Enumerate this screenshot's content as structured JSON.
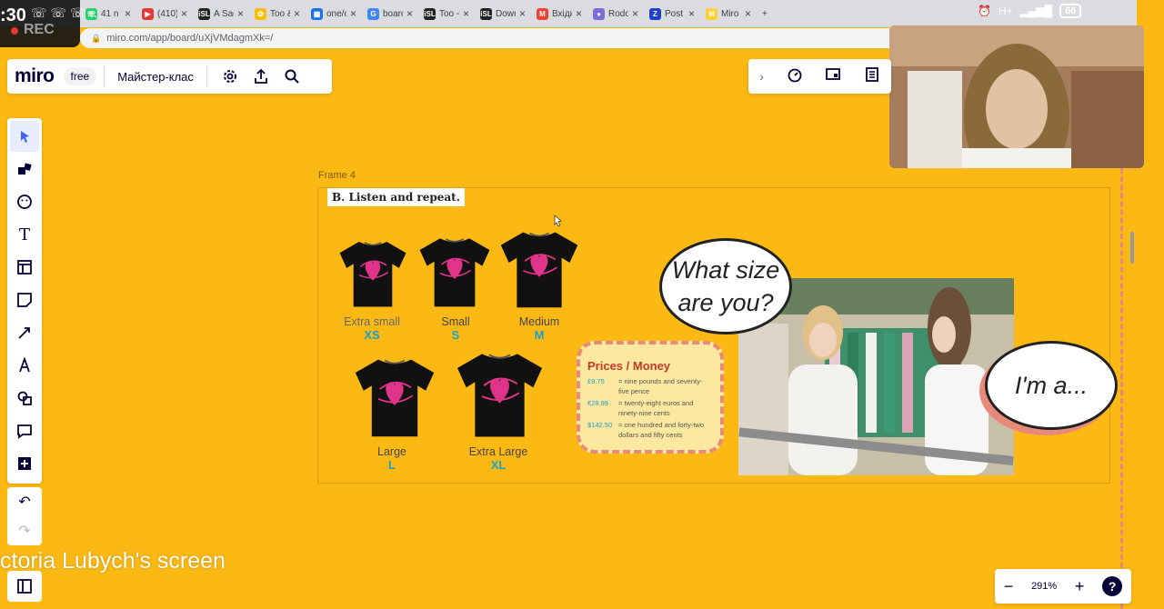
{
  "recording": {
    "time": ":30",
    "label": "REC"
  },
  "tabs": [
    {
      "label": "41 n",
      "color": "#25d366",
      "glyph": "☏"
    },
    {
      "label": "(410)",
      "color": "#e53935",
      "glyph": "▶"
    },
    {
      "label": "A Sad",
      "color": "#222222",
      "glyph": "iSL"
    },
    {
      "label": "Too &",
      "color": "#fbbc04",
      "glyph": "✿"
    },
    {
      "label": "one/c",
      "color": "#1a73e8",
      "glyph": "▦"
    },
    {
      "label": "board",
      "color": "#4285f4",
      "glyph": "G"
    },
    {
      "label": "Too -",
      "color": "#222222",
      "glyph": "iSL"
    },
    {
      "label": "Down",
      "color": "#222222",
      "glyph": "iSL"
    },
    {
      "label": "Вхідн",
      "color": "#ea4335",
      "glyph": "M"
    },
    {
      "label": "Rodo",
      "color": "#7b6cd9",
      "glyph": "●"
    },
    {
      "label": "Post A",
      "color": "#1e40c9",
      "glyph": "Z"
    },
    {
      "label": "Miro",
      "color": "#ffd02f",
      "glyph": "M"
    }
  ],
  "address": "miro.com/app/board/uXjVMdagmXk=/",
  "status": {
    "battery": "66",
    "net": "H+"
  },
  "toolbar": {
    "logo": "miro",
    "plan": "free",
    "board_name": "Майстер-клас"
  },
  "zoom": {
    "level": "291%",
    "minus": "−",
    "plus": "+",
    "help": "?"
  },
  "frame": {
    "label": "Frame 4",
    "title": "B. Listen and repeat."
  },
  "sizes": [
    {
      "name": "Extra small",
      "code": "XS"
    },
    {
      "name": "Small",
      "code": "S"
    },
    {
      "name": "Medium",
      "code": "M"
    },
    {
      "name": "Large",
      "code": "L"
    },
    {
      "name": "Extra Large",
      "code": "XL"
    }
  ],
  "prices": {
    "title": "Prices / Money",
    "rows": [
      {
        "amount": "£9.75",
        "text": "= nine pounds and seventy-five pence"
      },
      {
        "amount": "€28.99",
        "text": "= twenty-eight euros and ninety-nine cents"
      },
      {
        "amount": "$142.50",
        "text": "= one hundred and forty-two dollars and fifty cents"
      }
    ]
  },
  "bubbles": {
    "question": "What size are you?",
    "answer": "I'm a..."
  },
  "screen_caption": "ctoria Lubych's screen",
  "colors": {
    "board": "#fdb913",
    "accent": "#1aa0c9",
    "shirt_print": "#e0338a",
    "price_title": "#c0392b"
  }
}
